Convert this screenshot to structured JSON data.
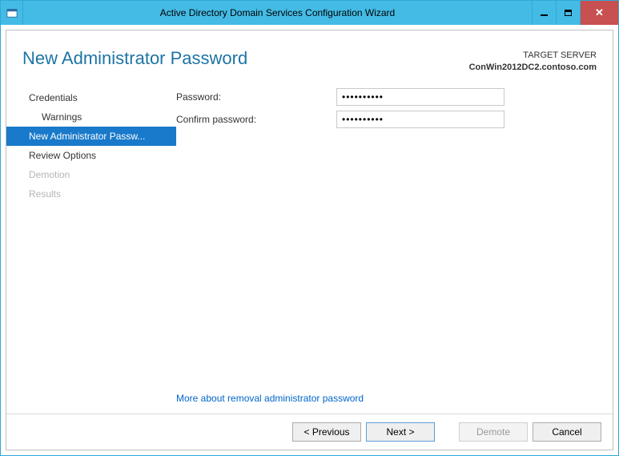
{
  "titlebar": {
    "title": "Active Directory Domain Services Configuration Wizard"
  },
  "header": {
    "page_title": "New Administrator Password",
    "target_label": "TARGET SERVER",
    "target_value": "ConWin2012DC2.contoso.com"
  },
  "steps": [
    {
      "label": "Credentials",
      "sub": false,
      "selected": false,
      "disabled": false
    },
    {
      "label": "Warnings",
      "sub": true,
      "selected": false,
      "disabled": false
    },
    {
      "label": "New Administrator Passw...",
      "sub": false,
      "selected": true,
      "disabled": false
    },
    {
      "label": "Review Options",
      "sub": false,
      "selected": false,
      "disabled": false
    },
    {
      "label": "Demotion",
      "sub": false,
      "selected": false,
      "disabled": true
    },
    {
      "label": "Results",
      "sub": false,
      "selected": false,
      "disabled": true
    }
  ],
  "form": {
    "password_label": "Password:",
    "confirm_label": "Confirm password:",
    "password_value": "••••••••••",
    "confirm_value": "••••••••••",
    "more_link": "More about removal administrator password"
  },
  "buttons": {
    "previous": "< Previous",
    "next": "Next >",
    "demote": "Demote",
    "cancel": "Cancel"
  }
}
